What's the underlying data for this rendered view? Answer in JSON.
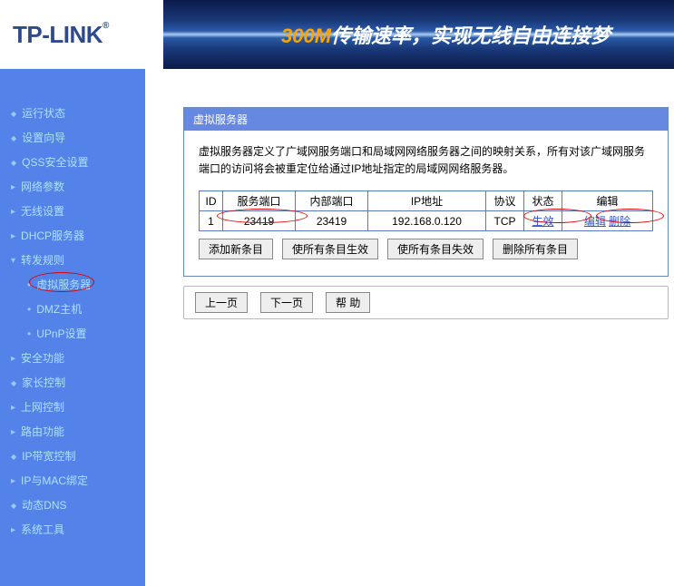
{
  "logo": "TP-LINK",
  "banner": {
    "highlight": "300M",
    "rest": "传输速率，实现无线自由连接梦"
  },
  "nav": {
    "items": [
      {
        "label": "运行状态",
        "type": "leaf"
      },
      {
        "label": "设置向导",
        "type": "leaf"
      },
      {
        "label": "QSS安全设置",
        "type": "leaf"
      },
      {
        "label": "网络参数",
        "type": "collapsed"
      },
      {
        "label": "无线设置",
        "type": "collapsed"
      },
      {
        "label": "DHCP服务器",
        "type": "collapsed"
      },
      {
        "label": "转发规则",
        "type": "expanded",
        "children": [
          {
            "label": "虚拟服务器",
            "active": true
          },
          {
            "label": "DMZ主机",
            "active": false
          },
          {
            "label": "UPnP设置",
            "active": false
          }
        ]
      },
      {
        "label": "安全功能",
        "type": "collapsed"
      },
      {
        "label": "家长控制",
        "type": "leaf"
      },
      {
        "label": "上网控制",
        "type": "collapsed"
      },
      {
        "label": "路由功能",
        "type": "collapsed"
      },
      {
        "label": "IP带宽控制",
        "type": "leaf"
      },
      {
        "label": "IP与MAC绑定",
        "type": "collapsed"
      },
      {
        "label": "动态DNS",
        "type": "leaf"
      },
      {
        "label": "系统工具",
        "type": "collapsed"
      }
    ]
  },
  "panel": {
    "title": "虚拟服务器",
    "desc": "虚拟服务器定义了广域网服务端口和局域网网络服务器之间的映射关系，所有对该广域网服务端口的访问将会被重定位给通过IP地址指定的局域网网络服务器。",
    "columns": {
      "id": "ID",
      "servicePort": "服务端口",
      "internalPort": "内部端口",
      "ip": "IP地址",
      "proto": "协议",
      "status": "状态",
      "edit": "编辑"
    },
    "rows": [
      {
        "id": "1",
        "servicePort": "23419",
        "internalPort": "23419",
        "ip": "192.168.0.120",
        "proto": "TCP",
        "status": "生效",
        "editLabel": "编辑",
        "deleteLabel": "删除"
      }
    ],
    "buttons": {
      "add": "添加新条目",
      "enableAll": "使所有条目生效",
      "disableAll": "使所有条目失效",
      "deleteAll": "删除所有条目"
    }
  },
  "pager": {
    "prev": "上一页",
    "next": "下一页",
    "help": "帮 助"
  }
}
